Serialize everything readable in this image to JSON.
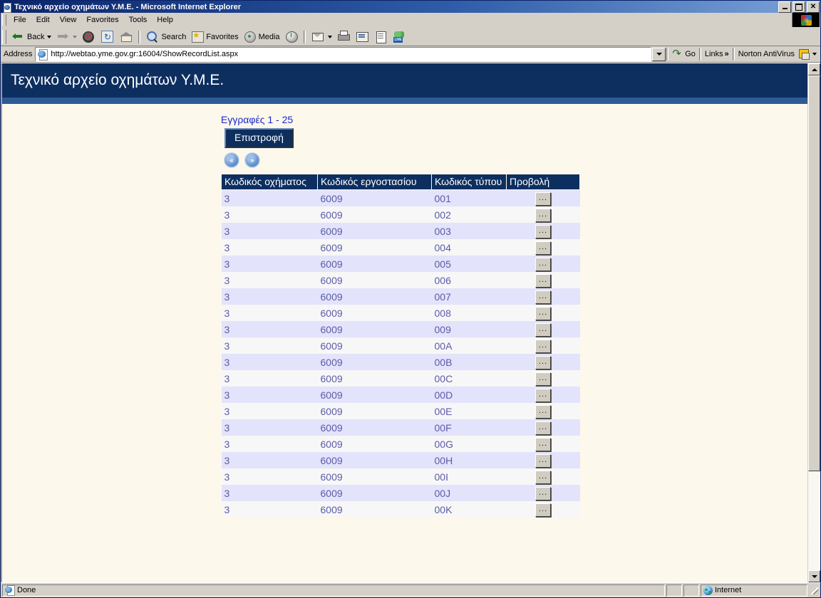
{
  "window": {
    "title": "Τεχνικό αρχείο οχημάτων Υ.Μ.Ε. - Microsoft Internet Explorer",
    "minimize_label": "Minimize",
    "restore_label": "Restore",
    "close_label": "✕"
  },
  "menu": {
    "items": [
      "File",
      "Edit",
      "View",
      "Favorites",
      "Tools",
      "Help"
    ]
  },
  "toolbar": {
    "back_label": "Back",
    "forward_label": "",
    "stop_label": "",
    "refresh_label": "",
    "home_label": "",
    "search_label": "Search",
    "favorites_label": "Favorites",
    "media_label": "Media",
    "history_label": "",
    "mail_label": "",
    "print_label": "",
    "edit_label": "",
    "discuss_label": "",
    "messenger_label": ""
  },
  "address": {
    "label": "Address",
    "url": "http://webtao.yme.gov.gr:16004/ShowRecordList.aspx",
    "go_label": "Go",
    "links_label": "Links",
    "links_chevron": "»",
    "norton_label": "Norton AntiVirus"
  },
  "page": {
    "header_title": "Τεχνικό αρχείο οχημάτων Υ.Μ.Ε.",
    "records_label": "Εγγραφές 1 - 25",
    "back_button": "Επιστροφή",
    "nav_first": "«",
    "nav_next": "»",
    "view_button_label": "...",
    "columns": [
      "Κωδικός οχήματος",
      "Κωδικός εργοστασίου",
      "Κωδικός τύπου",
      "Προβολή"
    ],
    "rows": [
      {
        "vehicle": "3",
        "factory": "6009",
        "type": "001"
      },
      {
        "vehicle": "3",
        "factory": "6009",
        "type": "002"
      },
      {
        "vehicle": "3",
        "factory": "6009",
        "type": "003"
      },
      {
        "vehicle": "3",
        "factory": "6009",
        "type": "004"
      },
      {
        "vehicle": "3",
        "factory": "6009",
        "type": "005"
      },
      {
        "vehicle": "3",
        "factory": "6009",
        "type": "006"
      },
      {
        "vehicle": "3",
        "factory": "6009",
        "type": "007"
      },
      {
        "vehicle": "3",
        "factory": "6009",
        "type": "008"
      },
      {
        "vehicle": "3",
        "factory": "6009",
        "type": "009"
      },
      {
        "vehicle": "3",
        "factory": "6009",
        "type": "00A"
      },
      {
        "vehicle": "3",
        "factory": "6009",
        "type": "00B"
      },
      {
        "vehicle": "3",
        "factory": "6009",
        "type": "00C"
      },
      {
        "vehicle": "3",
        "factory": "6009",
        "type": "00D"
      },
      {
        "vehicle": "3",
        "factory": "6009",
        "type": "00E"
      },
      {
        "vehicle": "3",
        "factory": "6009",
        "type": "00F"
      },
      {
        "vehicle": "3",
        "factory": "6009",
        "type": "00G"
      },
      {
        "vehicle": "3",
        "factory": "6009",
        "type": "00H"
      },
      {
        "vehicle": "3",
        "factory": "6009",
        "type": "00I"
      },
      {
        "vehicle": "3",
        "factory": "6009",
        "type": "00J"
      },
      {
        "vehicle": "3",
        "factory": "6009",
        "type": "00K"
      }
    ]
  },
  "status": {
    "text": "Done",
    "zone": "Internet"
  },
  "colors": {
    "header_navy": "#0d2f60",
    "accent_blue": "#2e5a94",
    "page_bg": "#fdf8ec",
    "row_odd": "#e3e3fb",
    "row_even": "#f7f7f7",
    "cell_text": "#5b5ba8",
    "link_blue": "#1a25c8"
  }
}
